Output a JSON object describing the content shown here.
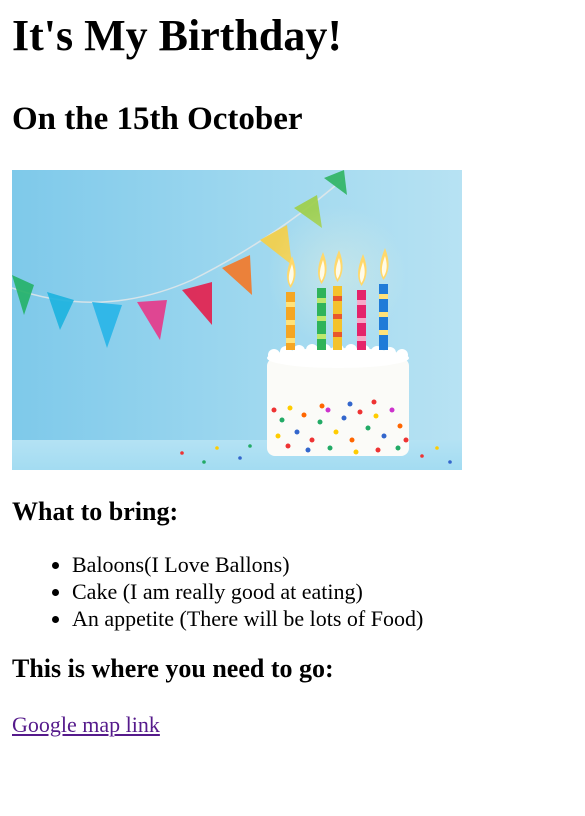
{
  "header": {
    "title": "It's My Birthday!",
    "subtitle": "On the 15th October"
  },
  "image": {
    "alt": "Birthday cake with candles and bunting",
    "colors": {
      "background": "#9ed6ee",
      "cake": "#fbfbf8"
    }
  },
  "bring": {
    "heading": "What to bring:",
    "items": [
      "Baloons(I Love Ballons)",
      "Cake (I am really good at eating)",
      "An appetite (There will be lots of Food)"
    ]
  },
  "directions": {
    "heading": "This is where you need to go:",
    "link_text": "Google map link",
    "link_color": "#551a8b"
  }
}
